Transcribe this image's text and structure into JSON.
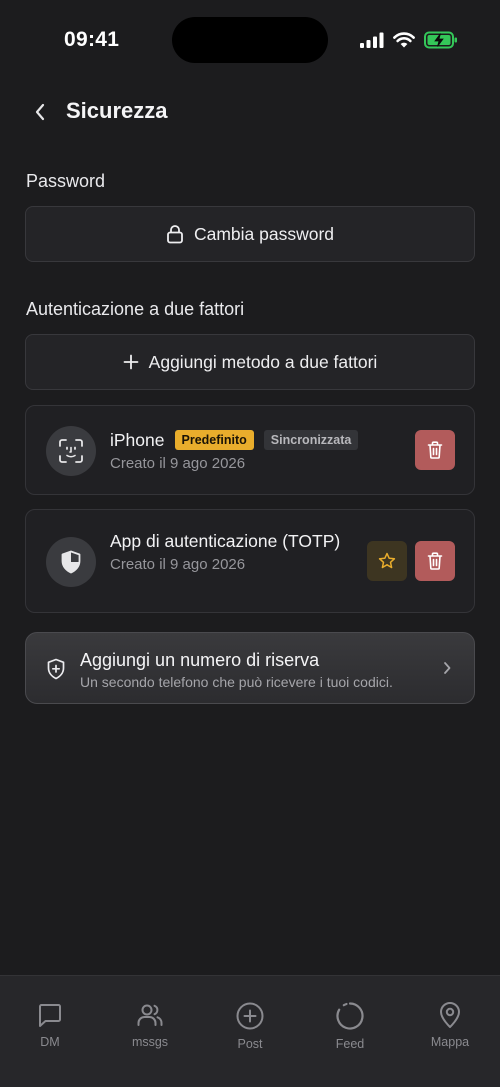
{
  "status_bar": {
    "time": "09:41"
  },
  "header": {
    "title": "Sicurezza"
  },
  "password_section": {
    "label": "Password",
    "button_label": "Cambia password"
  },
  "two_factor_section": {
    "label": "Autenticazione a due fattori",
    "add_button_label": "Aggiungi metodo a due fattori",
    "methods": [
      {
        "name": "iPhone",
        "badge_default": "Predefinito",
        "badge_sync": "Sincronizzata",
        "created": "Creato il 9 ago 2026",
        "icon": "face-id-icon"
      },
      {
        "name": "App di autenticazione (TOTP)",
        "created": "Creato il 9 ago 2026",
        "icon": "shield-icon"
      }
    ]
  },
  "backup_card": {
    "title": "Aggiungi un numero di riserva",
    "subtitle": "Un secondo telefono che può ricevere i tuoi codici."
  },
  "tab_bar": {
    "items": [
      {
        "label": "DM",
        "icon": "message-icon"
      },
      {
        "label": "mssgs",
        "icon": "users-icon"
      },
      {
        "label": "Post",
        "icon": "plus-circle-icon"
      },
      {
        "label": "Feed",
        "icon": "circle-icon"
      },
      {
        "label": "Mappa",
        "icon": "map-pin-icon"
      }
    ]
  },
  "colors": {
    "background": "#1c1c1e",
    "badge_default": "#e9ad2c",
    "delete_button": "#b25b5b",
    "battery_charging": "#34c759"
  }
}
